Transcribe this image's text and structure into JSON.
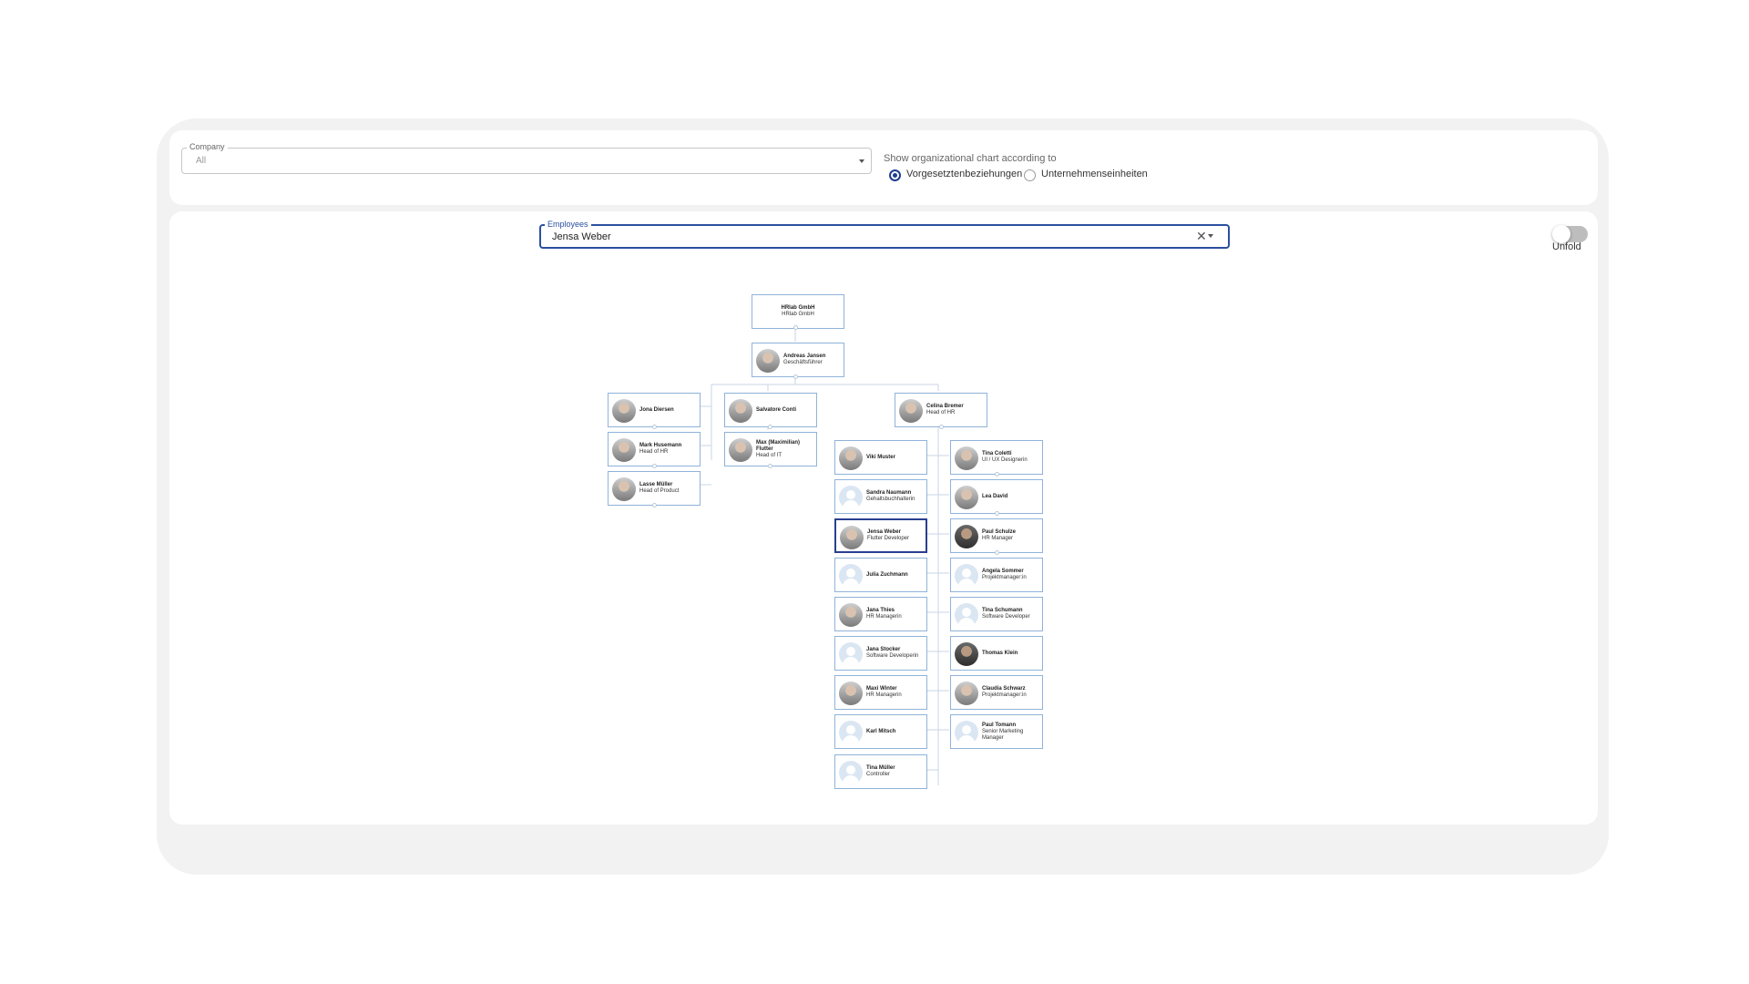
{
  "filters": {
    "company_label": "Company",
    "company_value": "All",
    "radio_title": "Show organizational chart according to",
    "radio_options": [
      {
        "label": "Vorgesetztenbeziehungen",
        "selected": true
      },
      {
        "label": "Unternehmenseinheiten",
        "selected": false
      }
    ]
  },
  "employees_field": {
    "label": "Employees",
    "value": "Jensa Weber"
  },
  "unfold": {
    "label": "Unfold",
    "on": false
  },
  "org": {
    "company": {
      "name": "HRlab GmbH",
      "role": "HRlab GmbH"
    },
    "ceo": {
      "name": "Andreas Jansen",
      "role": "Geschäftsführer"
    },
    "col_a": [
      {
        "name": "Jona Diersen",
        "role": ""
      },
      {
        "name": "Mark Husemann",
        "role": "Head of HR"
      },
      {
        "name": "Lasse Müller",
        "role": "Head of Product"
      }
    ],
    "col_b": [
      {
        "name": "Salvatore Conti",
        "role": ""
      },
      {
        "name": "Max (Maximilian) Flutter",
        "role": "Head of IT"
      }
    ],
    "head": {
      "name": "Celina Bremer",
      "role": "Head of HR"
    },
    "col_left": [
      {
        "name": "Viki Muster",
        "role": ""
      },
      {
        "name": "Sandra Naumann",
        "role": "Gehaltsbuchhalterin"
      },
      {
        "name": "Jensa Weber",
        "role": "Flutter Developer",
        "selected": true
      },
      {
        "name": "Julia Zuchmann",
        "role": ""
      },
      {
        "name": "Jana Thies",
        "role": "HR Managerin"
      },
      {
        "name": "Jana Stocker",
        "role": "Software Developerin"
      },
      {
        "name": "Maxi Winter",
        "role": "HR Managerin"
      },
      {
        "name": "Karl Mitsch",
        "role": ""
      },
      {
        "name": "Tina Müller",
        "role": "Controller"
      }
    ],
    "col_right": [
      {
        "name": "Tina Coletti",
        "role": "UI / UX Designerin"
      },
      {
        "name": "Lea David",
        "role": ""
      },
      {
        "name": "Paul Schulze",
        "role": "HR Manager"
      },
      {
        "name": "Angela Sommer",
        "role": "Projektmanager:in"
      },
      {
        "name": "Tina Schumann",
        "role": "Software Developer"
      },
      {
        "name": "Thomas Klein",
        "role": ""
      },
      {
        "name": "Claudia Schwarz",
        "role": "Projektmanager:in"
      },
      {
        "name": "Paul Tomann",
        "role": "Senior Marketing Manager"
      }
    ]
  }
}
